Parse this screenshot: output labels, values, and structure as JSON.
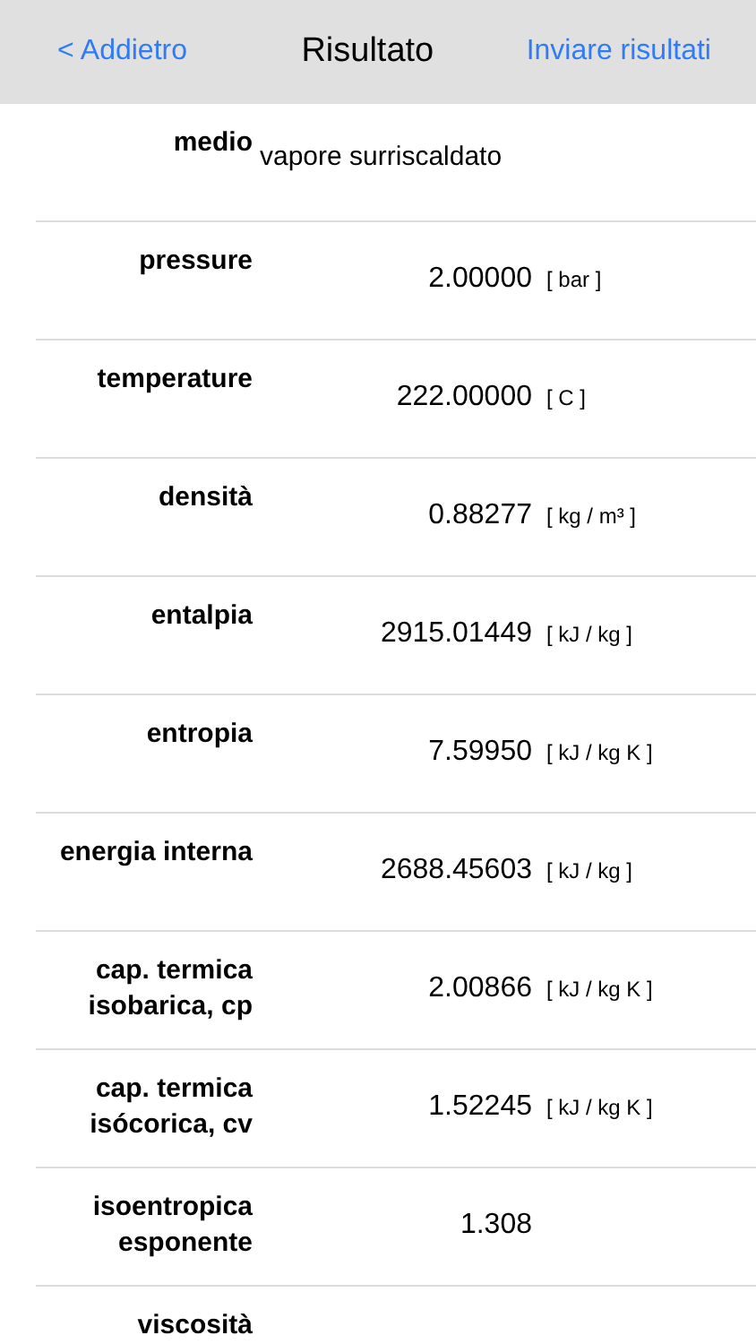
{
  "nav": {
    "back": "< Addietro",
    "title": "Risultato",
    "action": "Inviare risultati"
  },
  "rows": [
    {
      "label": "medio",
      "kind": "text",
      "value": "vapore surriscaldato"
    },
    {
      "label": "pressure",
      "kind": "number",
      "value": "2.00000",
      "unit": "[ bar ]"
    },
    {
      "label": "temperature",
      "kind": "number",
      "value": "222.00000",
      "unit": "[ C ]"
    },
    {
      "label": "densità",
      "kind": "number",
      "value": "0.88277",
      "unit": "[ kg / m³ ]"
    },
    {
      "label": "entalpia",
      "kind": "number",
      "value": "2915.01449",
      "unit": "[ kJ / kg ]"
    },
    {
      "label": "entropia",
      "kind": "number",
      "value": "7.59950",
      "unit": "[ kJ / kg K ]"
    },
    {
      "label": "energia interna",
      "kind": "number",
      "value": "2688.45603",
      "unit": "[ kJ / kg ]"
    },
    {
      "label": "cap. termica isobarica, cp",
      "kind": "number",
      "value": "2.00866",
      "unit": "[ kJ / kg K ]"
    },
    {
      "label": "cap. termica isócorica, cv",
      "kind": "number",
      "value": "1.52245",
      "unit": "[ kJ / kg K ]"
    },
    {
      "label": "isoentropica esponente",
      "kind": "number",
      "value": "1.308"
    },
    {
      "label": "viscosità",
      "kind": "cut"
    }
  ]
}
